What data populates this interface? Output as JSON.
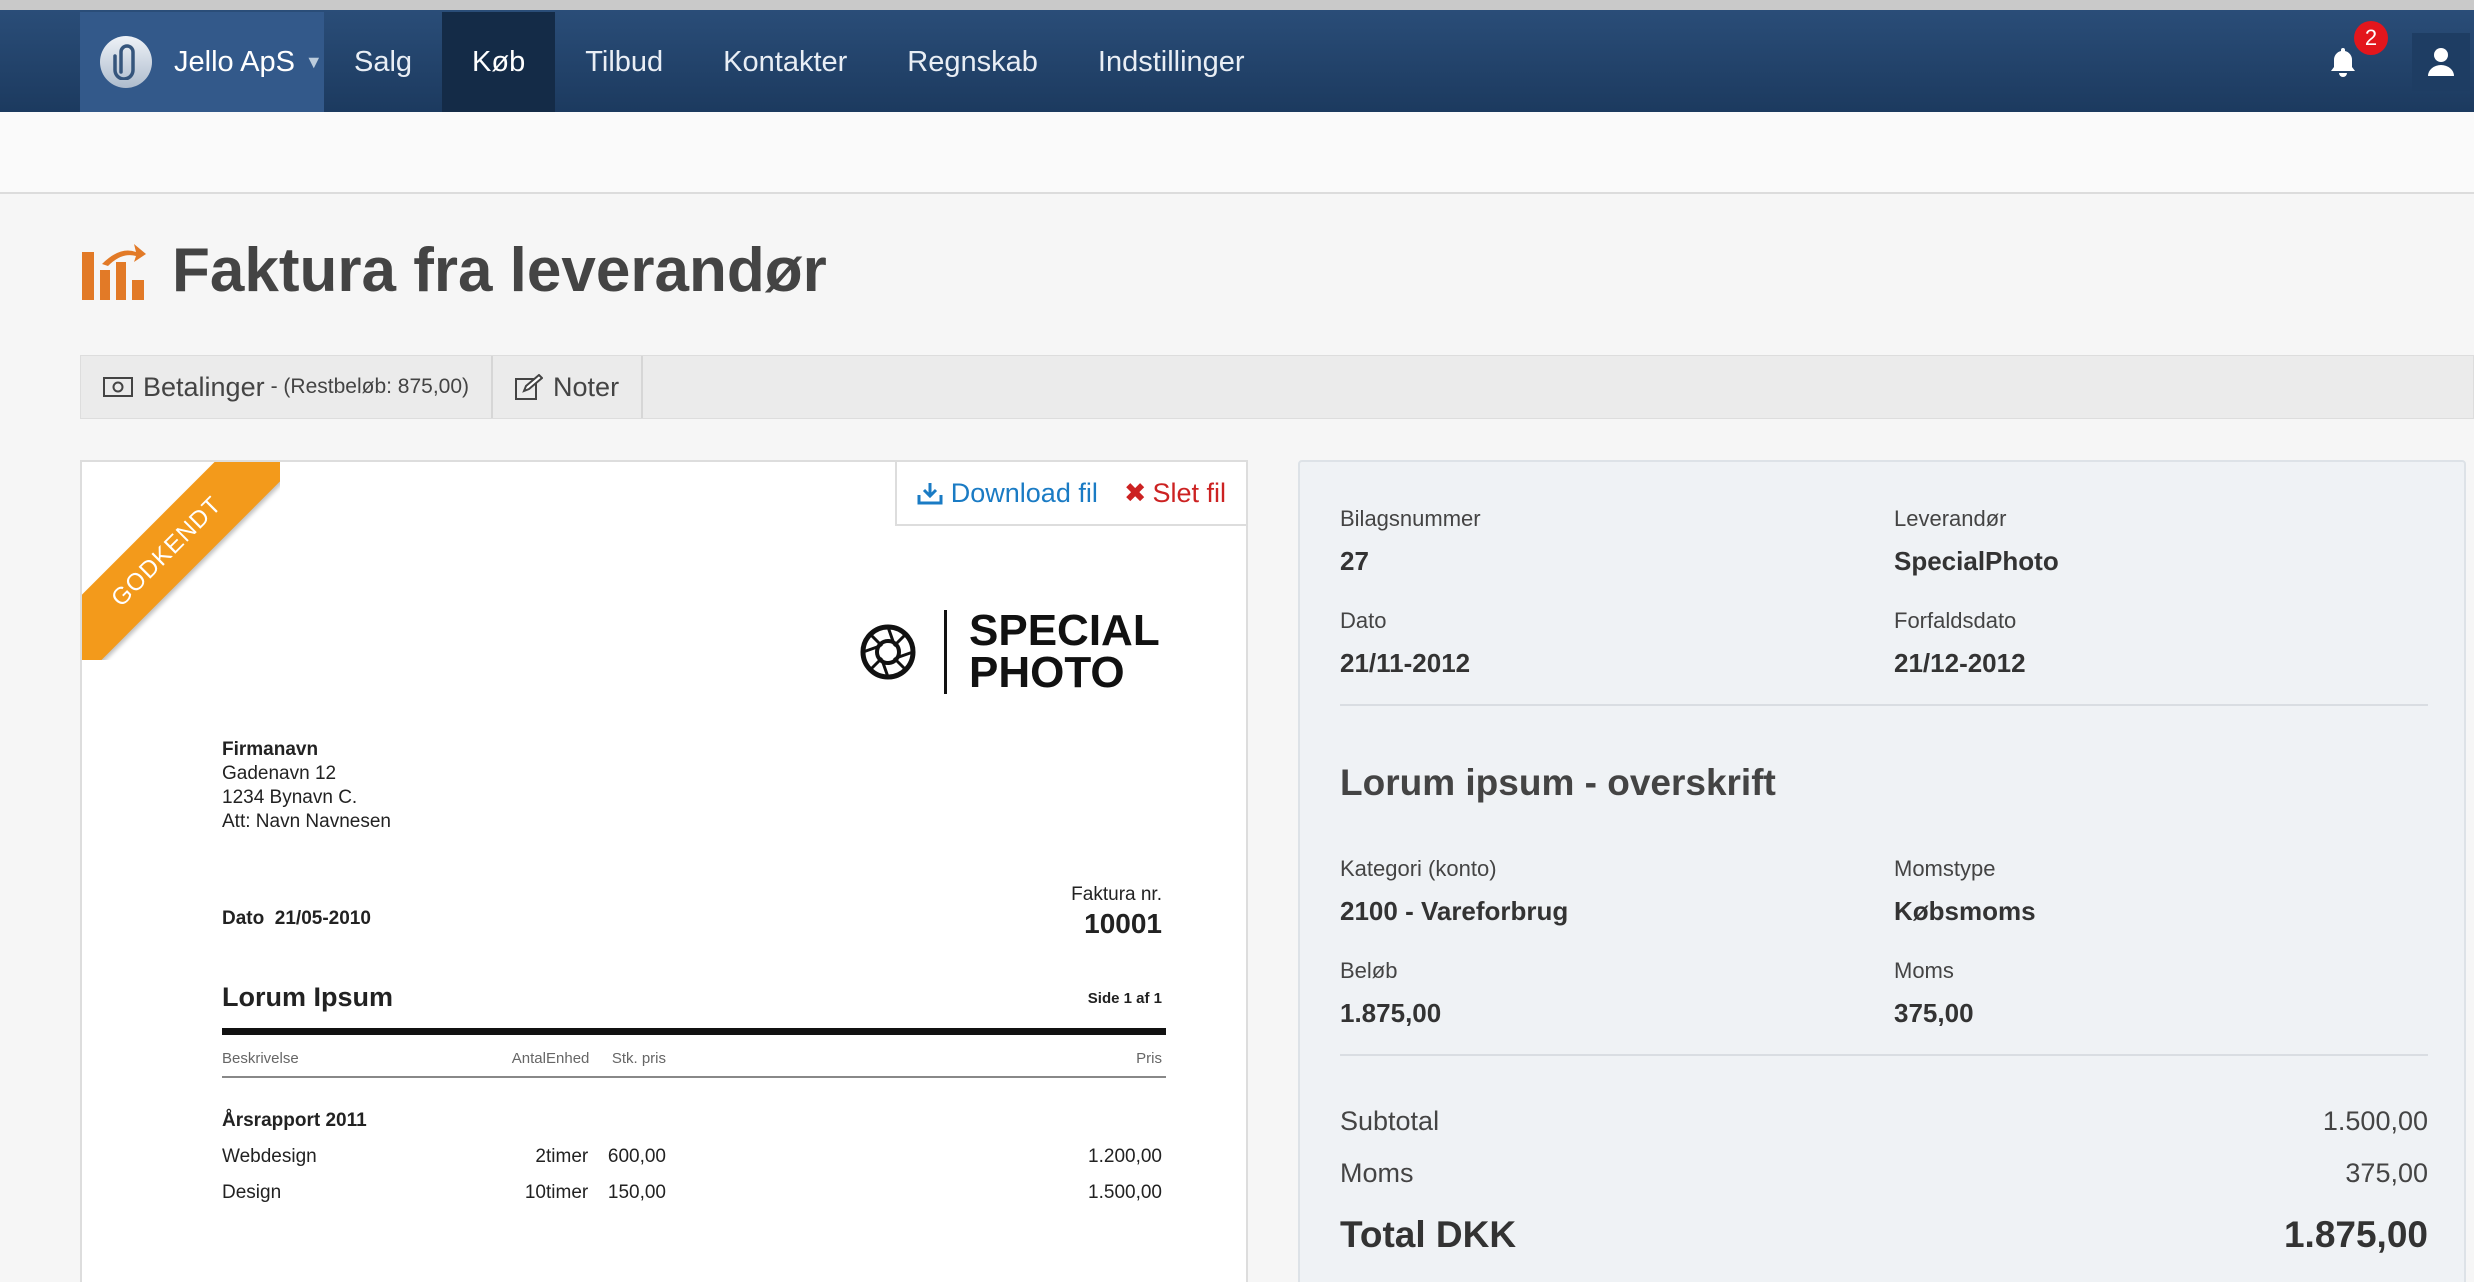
{
  "nav": {
    "company": "Jello ApS",
    "items": [
      {
        "label": "Salg"
      },
      {
        "label": "Køb"
      },
      {
        "label": "Tilbud"
      },
      {
        "label": "Kontakter"
      },
      {
        "label": "Regnskab"
      },
      {
        "label": "Indstillinger"
      }
    ],
    "active_index": 1,
    "notification_count": "2"
  },
  "page": {
    "title": "Faktura fra leverandør"
  },
  "tabs": {
    "payments_label": "Betalinger",
    "payments_sub": "- (Restbeløb: 875,00)",
    "notes_label": "Noter"
  },
  "document": {
    "download_label": "Download fil",
    "delete_label": "Slet fil",
    "status_ribbon": "GODKENDT",
    "logo_line1": "SPECIAL",
    "logo_line2": "PHOTO",
    "address": {
      "name": "Firmanavn",
      "street": "Gadenavn 12",
      "city": "1234 Bynavn C.",
      "att": "Att: Navn Navnesen"
    },
    "date_label": "Dato",
    "date_value": "21/05-2010",
    "invoice_no_label": "Faktura nr.",
    "invoice_no": "10001",
    "heading": "Lorum Ipsum",
    "page_info": "Side 1 af 1",
    "columns": {
      "desc": "Beskrivelse",
      "qty": "Antal",
      "unit": "Enhed",
      "unit_price": "Stk. pris",
      "price": "Pris"
    },
    "group_title": "Årsrapport 2011",
    "lines": [
      {
        "desc": "Webdesign",
        "qty": "2",
        "unit": "timer",
        "unit_price": "600,00",
        "price": "1.200,00"
      },
      {
        "desc": "Design",
        "qty": "10",
        "unit": "timer",
        "unit_price": "150,00",
        "price": "1.500,00"
      }
    ]
  },
  "details": {
    "bilag_label": "Bilagsnummer",
    "bilag_value": "27",
    "supplier_label": "Leverandør",
    "supplier_value": "SpecialPhoto",
    "date_label": "Dato",
    "date_value": "21/11-2012",
    "due_label": "Forfaldsdato",
    "due_value": "21/12-2012",
    "description": "Lorum ipsum - overskrift",
    "category_label": "Kategori (konto)",
    "category_value": "2100 - Vareforbrug",
    "vat_type_label": "Momstype",
    "vat_type_value": "Købsmoms",
    "amount_label": "Beløb",
    "amount_value": "1.875,00",
    "vat_label": "Moms",
    "vat_value": "375,00",
    "subtotal_label": "Subtotal",
    "subtotal_value": "1.500,00",
    "moms_label": "Moms",
    "moms_value": "375,00",
    "total_label": "Total DKK",
    "total_value": "1.875,00"
  },
  "colors": {
    "nav_bg": "#1c3a5f",
    "nav_active": "#142b47",
    "ribbon": "#f39a1b",
    "link_blue": "#1a7bc4",
    "delete_red": "#cc2222",
    "badge_red": "#e3161c"
  }
}
